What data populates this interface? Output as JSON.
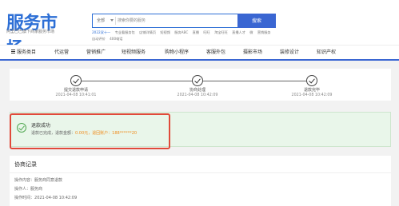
{
  "header": {
    "logo_text": "服务市场",
    "logo_subtitle": "阿里巴巴旗下商家服务市场",
    "search": {
      "category": "全部",
      "placeholder": "搜索你要的服务",
      "button_label": "搜索"
    },
    "hot_links": [
      "2022双十一",
      "专业看服务包",
      "店铺详情页",
      "短视频",
      "服务ABC",
      "直播",
      "旺旺",
      "淘宝旺旺",
      "直播人才",
      "微",
      "营销服务",
      "自动评价",
      "400电话"
    ]
  },
  "nav": {
    "items": [
      "服务类目",
      "代运营",
      "营销推广",
      "短视频服务",
      "购物小程序",
      "客服外包",
      "摄影市场",
      "装修设计",
      "知识产权"
    ]
  },
  "progress": {
    "steps": [
      {
        "label": "提交退款申请",
        "time": "2021-04-08 10:41:01"
      },
      {
        "label": "协商处理",
        "time": "2021-04-08 10:42:09"
      },
      {
        "label": "退款完毕",
        "time": "2021-04-08 10:42:09"
      }
    ]
  },
  "refund": {
    "title": "退款成功",
    "detail_prefix": "退款已完成，退款金额：",
    "amount": "0.00元",
    "account_label": "，退回账户：",
    "account": "188******20"
  },
  "records": {
    "title": "协商记录",
    "content_label": "操作内容：",
    "content_value": "服务商同意退款",
    "operator_label": "操作人：",
    "operator_value": "服务商",
    "time_label": "操作时间：",
    "time_value": "2021-04-08 10:42:09"
  },
  "colors": {
    "brand": "#2d6fd6",
    "accent_orange": "#f08c1c",
    "success_green": "#52a852",
    "highlight_red": "#e04a3a"
  }
}
